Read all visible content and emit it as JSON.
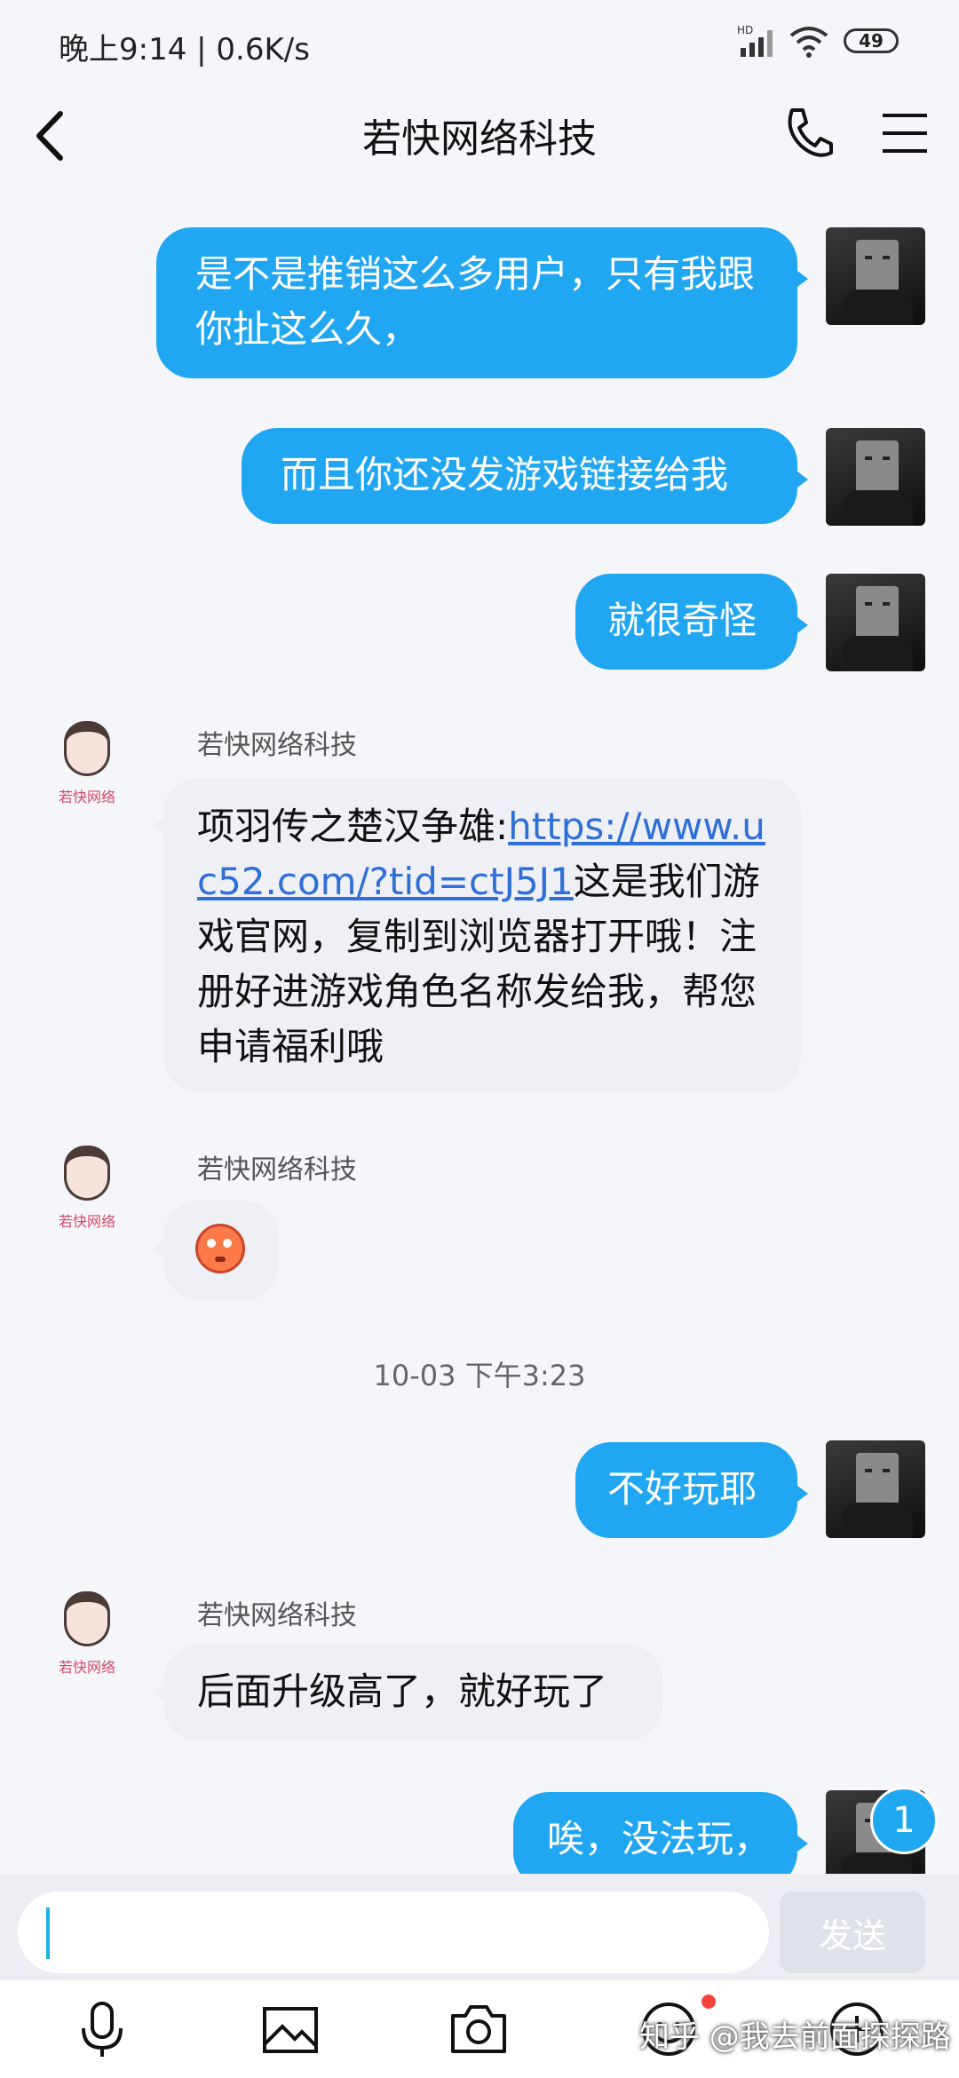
{
  "status_bar": {
    "time_speed": "晚上9:14 | 0.6K/s",
    "battery": "49",
    "network_label": "HD"
  },
  "header": {
    "title": "若快网络科技"
  },
  "messages": {
    "m1": {
      "text": "是不是推销这么多用户，只有我跟你扯这么久，"
    },
    "m2": {
      "text": "而且你还没发游戏链接给我"
    },
    "m3": {
      "text": "就很奇怪"
    },
    "m4": {
      "sender": "若快网络科技",
      "prefix": "项羽传之楚汉争雄:",
      "link": "https://www.uc52.com/?tid=ctJ5J1",
      "suffix": "这是我们游戏官网，复制到浏览器打开哦！注册好进游戏角色名称发给我，帮您申请福利哦"
    },
    "m5": {
      "sender": "若快网络科技",
      "emoji": "flushed-face-emoji"
    },
    "timestamp": "10-03 下午3:23",
    "m6": {
      "text": "不好玩耶"
    },
    "m7": {
      "sender": "若快网络科技",
      "text": "后面升级高了，就好玩了"
    },
    "m8": {
      "text": "唉，没法玩，",
      "unread_badge": "1"
    }
  },
  "avatar_other_label": "若快网络",
  "input": {
    "value": "",
    "send_label": "发送"
  },
  "toolbar_icons": [
    "microphone-icon",
    "image-icon",
    "camera-icon",
    "emoji-icon",
    "plus-icon"
  ],
  "watermark": "知乎 @我去前面探探路",
  "colors": {
    "self_bubble": "#21a7f2",
    "other_bubble": "#eef0f6",
    "link": "#2f6fd8"
  }
}
